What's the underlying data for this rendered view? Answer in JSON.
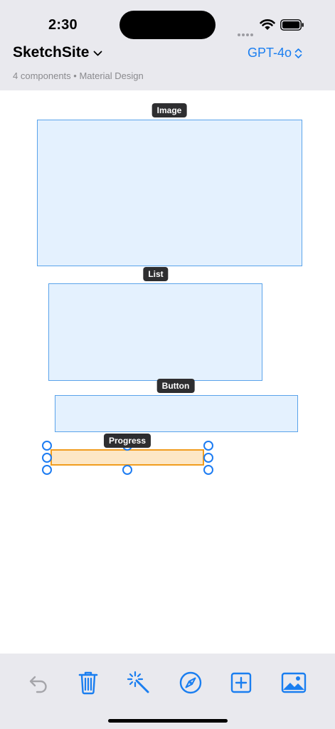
{
  "status_bar": {
    "time": "2:30"
  },
  "header": {
    "app_title": "SketchSite",
    "model": "GPT-4o",
    "subtitle": "4 components • Material Design"
  },
  "components": [
    {
      "label": "Image"
    },
    {
      "label": "List"
    },
    {
      "label": "Button"
    },
    {
      "label": "Progress",
      "selected": true
    }
  ],
  "toolbar": {
    "items": [
      {
        "icon": "undo-icon",
        "enabled": false
      },
      {
        "icon": "trash-icon",
        "enabled": true
      },
      {
        "icon": "magic-wand-icon",
        "enabled": true
      },
      {
        "icon": "compass-icon",
        "enabled": true
      },
      {
        "icon": "add-square-icon",
        "enabled": true
      },
      {
        "icon": "photo-icon",
        "enabled": true
      }
    ]
  },
  "colors": {
    "accent": "#1a7ef0",
    "component_fill": "#e4f1fe",
    "component_border": "#5aa3ea",
    "selected_fill": "#fde7c6",
    "selected_border": "#f19d1f",
    "disabled": "#a5a5aa"
  }
}
